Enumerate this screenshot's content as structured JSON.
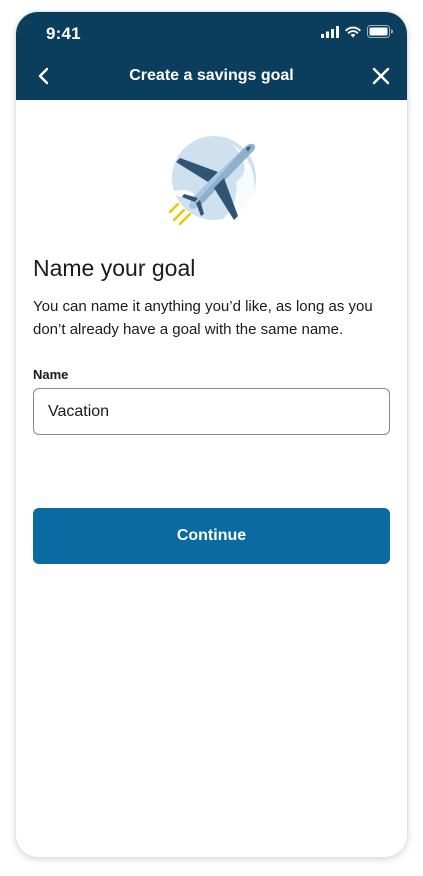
{
  "status_bar": {
    "time": "9:41",
    "icons": [
      "signal-icon",
      "wifi-icon",
      "battery-icon"
    ]
  },
  "nav": {
    "back_icon": "chevron-left-icon",
    "title": "Create a savings goal",
    "close_icon": "close-icon"
  },
  "illustration": {
    "icon": "airplane-icon"
  },
  "content": {
    "heading": "Name your goal",
    "description": "You can name it anything you’d like, as long as you don’t already have a goal with the same name."
  },
  "form": {
    "name_label": "Name",
    "name_value": "Vacation",
    "name_placeholder": ""
  },
  "actions": {
    "continue_label": "Continue"
  },
  "colors": {
    "header_bg": "#0b3d5d",
    "primary_button": "#0b6aa2",
    "text": "#1a1a1a",
    "input_border": "#8a8a8a",
    "accent_yellow": "#f2c400"
  }
}
